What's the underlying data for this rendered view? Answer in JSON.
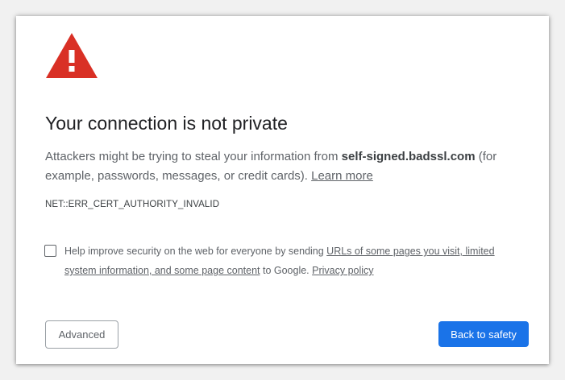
{
  "colors": {
    "warning_red": "#d93025",
    "primary_blue": "#1a73e8"
  },
  "icon": "warning-triangle-icon",
  "title": "Your connection is not private",
  "description": {
    "prefix": "Attackers might be trying to steal your information from ",
    "host": "self-signed.badssl.com",
    "suffix": " (for example, passwords, messages, or credit cards). ",
    "learn_more": "Learn more"
  },
  "error_code": "NET::ERR_CERT_AUTHORITY_INVALID",
  "report": {
    "checked": false,
    "prefix": "Help improve security on the web for everyone by sending ",
    "link_data": "URLs of some pages you visit, limited system information, and some page content",
    "middle": " to Google. ",
    "privacy_link": "Privacy policy"
  },
  "buttons": {
    "advanced": "Advanced",
    "back": "Back to safety"
  }
}
